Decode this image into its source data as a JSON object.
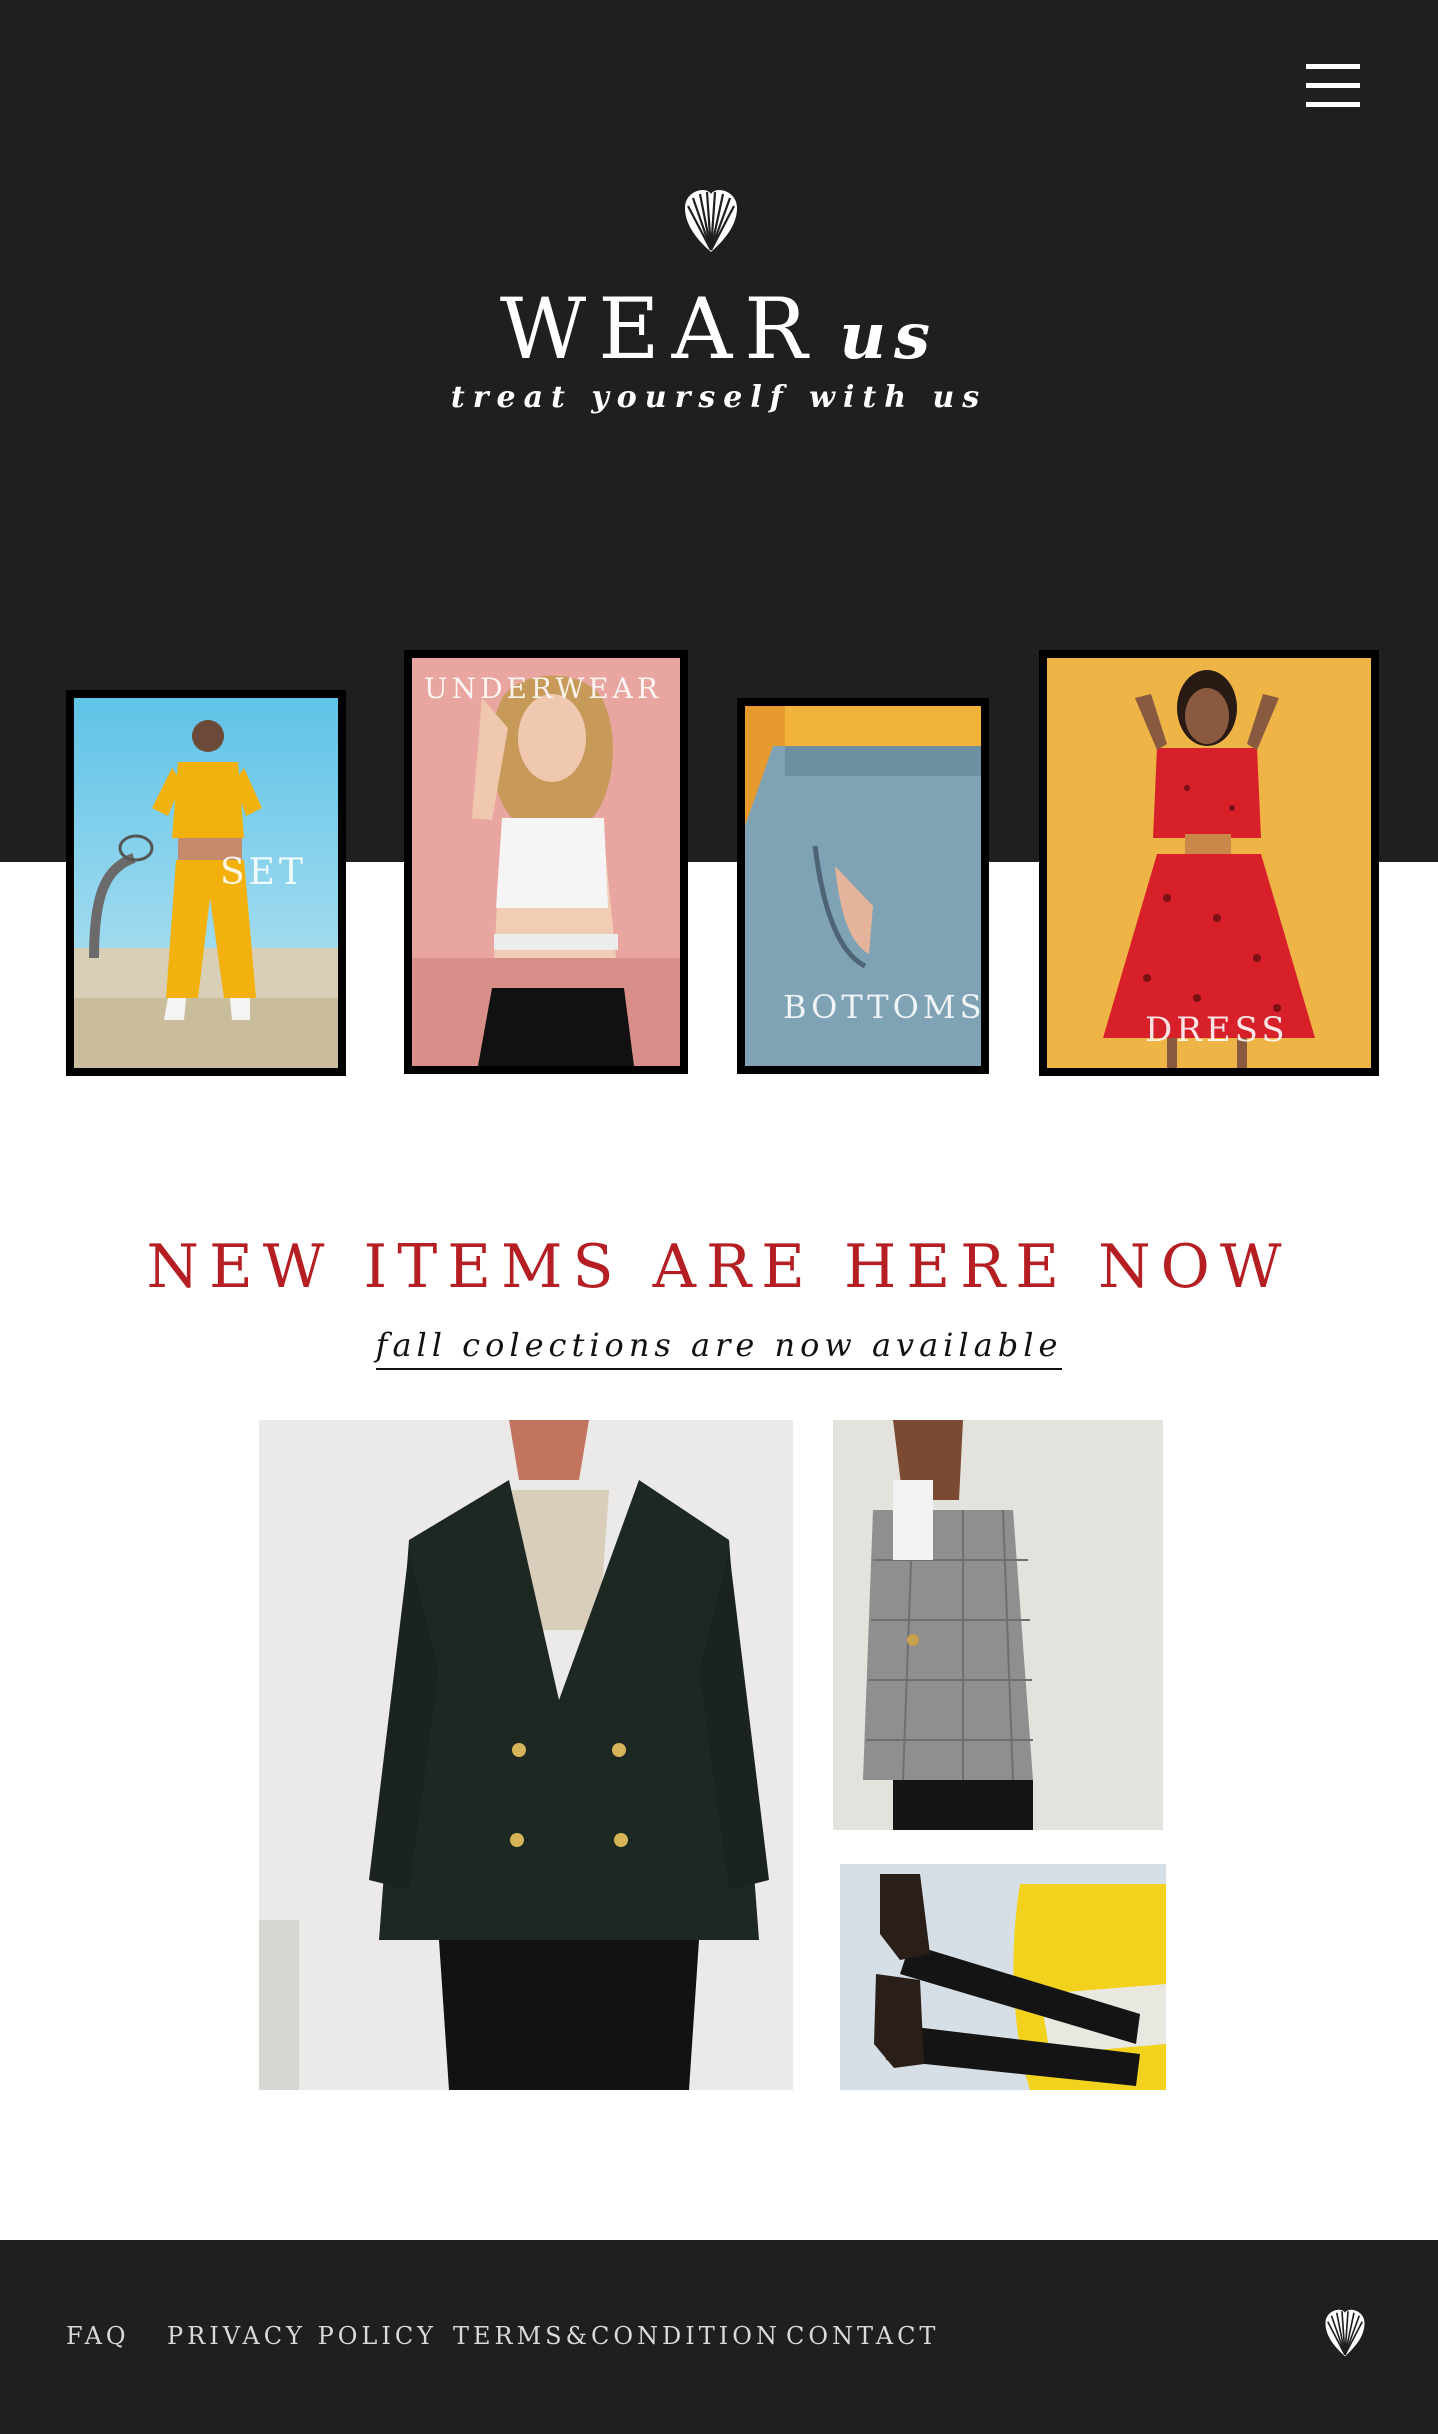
{
  "header": {
    "brand_main": "WEAR",
    "brand_script": "us",
    "tagline": "treat yourself with us",
    "logo_icon": "heart-shell-icon",
    "menu_icon": "hamburger-menu-icon"
  },
  "categories": [
    {
      "label": "SET"
    },
    {
      "label": "UNDERWEAR"
    },
    {
      "label": "BOTTOMS"
    },
    {
      "label": "DRESS"
    }
  ],
  "new_items": {
    "title": "NEW ITEMS ARE HERE NOW",
    "subtitle": "fall colections are now available"
  },
  "footer": {
    "links": [
      "FAQ",
      "PRIVACY POLICY",
      "TERMS&CONDITION",
      "CONTACT"
    ],
    "logo_icon": "heart-shell-icon"
  },
  "colors": {
    "dark": "#1f1f1f",
    "accent": "#b51f23",
    "text_light": "#ffffff"
  }
}
